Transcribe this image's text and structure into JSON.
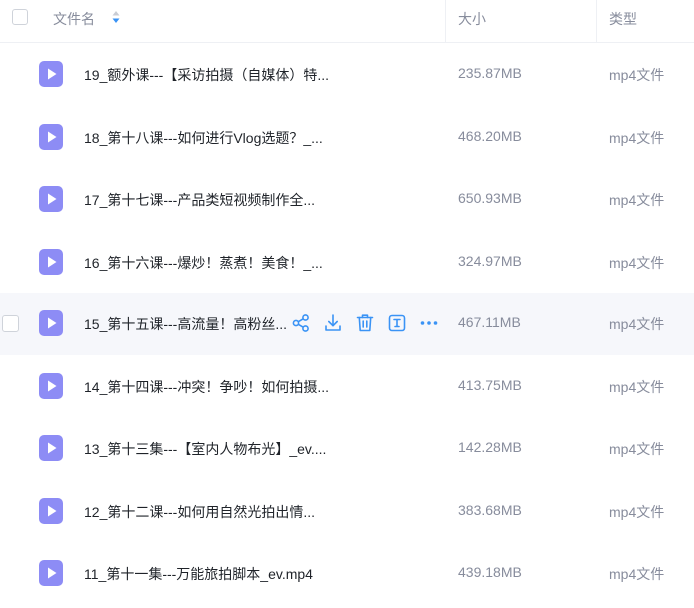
{
  "header": {
    "name_label": "文件名",
    "size_label": "大小",
    "type_label": "类型"
  },
  "colors": {
    "accent": "#3a93f5",
    "file_icon": "#8d8cf5",
    "text_primary": "#1f2329",
    "text_secondary": "#878c9c",
    "hover_row": "#f6f7fb"
  },
  "icons": {
    "file": "video-file-icon",
    "sort": "sort-icon",
    "share": "share-icon",
    "download": "download-icon",
    "delete": "trash-icon",
    "rename": "rename-icon",
    "more": "more-icon"
  },
  "files": [
    {
      "name": "19_额外课---【采访拍摄（自媒体）特...",
      "size": "235.87MB",
      "type": "mp4文件"
    },
    {
      "name": "18_第十八课---如何进行Vlog选题？_...",
      "size": "468.20MB",
      "type": "mp4文件"
    },
    {
      "name": "17_第十七课---产品类短视频制作全...",
      "size": "650.93MB",
      "type": "mp4文件"
    },
    {
      "name": "16_第十六课---爆炒！蒸煮！美食！_...",
      "size": "324.97MB",
      "type": "mp4文件"
    },
    {
      "name": "15_第十五课---高流量！高粉丝...",
      "size": "467.11MB",
      "type": "mp4文件"
    },
    {
      "name": "14_第十四课---冲突！争吵！如何拍摄...",
      "size": "413.75MB",
      "type": "mp4文件"
    },
    {
      "name": "13_第十三集---【室内人物布光】_ev....",
      "size": "142.28MB",
      "type": "mp4文件"
    },
    {
      "name": "12_第十二课---如何用自然光拍出情...",
      "size": "383.68MB",
      "type": "mp4文件"
    },
    {
      "name": "11_第十一集---万能旅拍脚本_ev.mp4",
      "size": "439.18MB",
      "type": "mp4文件"
    }
  ]
}
